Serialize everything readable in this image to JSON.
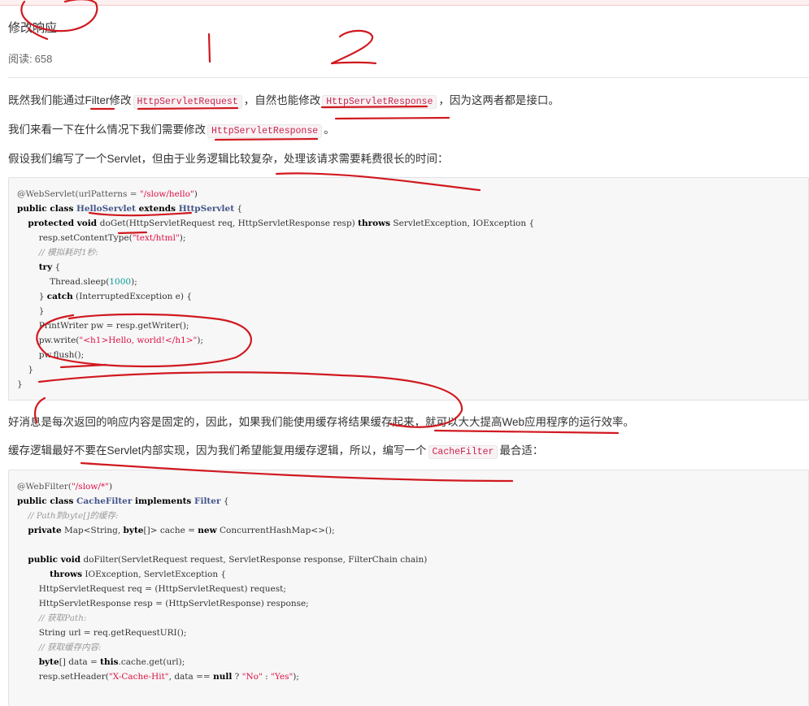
{
  "article": {
    "title": "修改响应",
    "reads_label": "阅读:",
    "reads_count": "658",
    "p1": {
      "t1": "既然我们能通过Filter修改",
      "c1": "HttpServletRequest",
      "t2": "，自然也能修改",
      "c2": "HttpServletResponse",
      "t3": "，因为这两者都是接口。"
    },
    "p2": {
      "t1": "我们来看一下在什么情况下我们需要修改",
      "c1": "HttpServletResponse",
      "t2": "。"
    },
    "p3": "假设我们编写了一个Servlet，但由于业务逻辑比较复杂，处理该请求需要耗费很长的时间：",
    "p4": "好消息是每次返回的响应内容是固定的，因此，如果我们能使用缓存将结果缓存起来，就可以大大提高Web应用程序的运行效率。",
    "p5": {
      "t1": "缓存逻辑最好不要在Servlet内部实现，因为我们希望能复用缓存逻辑，所以，编写一个",
      "c1": "CacheFilter",
      "t2": "最合适："
    }
  },
  "code1": {
    "l1a": "@WebServlet(urlPatterns = ",
    "l1s": "\"/slow/hello\"",
    "l1b": ")",
    "l2k1": "public class ",
    "l2c1": "HelloServlet",
    "l2k2": " extends ",
    "l2c2": "HttpServlet",
    "l2b": " {",
    "l3k1": "protected void ",
    "l3a": "doGet(HttpServletRequest req, HttpServletResponse resp) ",
    "l3k2": "throws",
    "l3b": " ServletException, IOException {",
    "l4a": "resp.setContentType(",
    "l4s": "\"text/html\"",
    "l4b": ");",
    "l5": "// 模拟耗时1秒:",
    "l6k": "try",
    "l6b": " {",
    "l7a": "Thread.sleep(",
    "l7n": "1000",
    "l7b": ");",
    "l8a": "} ",
    "l8k": "catch",
    "l8b": " (InterruptedException e) {",
    "l9": "}",
    "l10": "PrintWriter pw = resp.getWriter();",
    "l11a": "pw.write(",
    "l11s": "\"<h1>Hello, world!</h1>\"",
    "l11b": ");",
    "l12": "pw.flush();",
    "l13": "}",
    "l14": "}"
  },
  "code2": {
    "l1a": "@WebFilter(",
    "l1s": "\"/slow/*\"",
    "l1b": ")",
    "l2k1": "public class ",
    "l2c1": "CacheFilter",
    "l2k2": " implements ",
    "l2c2": "Filter",
    "l2b": " {",
    "l3": "// Path到byte[]的缓存:",
    "l4k1": "private",
    "l4a": " Map<String, ",
    "l4k2": "byte",
    "l4b": "[]> cache = ",
    "l4k3": "new",
    "l4c": " ConcurrentHashMap<>();",
    "l5": "",
    "l6k": "public void",
    "l6a": " doFilter(ServletRequest request, ServletResponse response, FilterChain chain)",
    "l7k": "throws",
    "l7a": " IOException, ServletException {",
    "l8": "HttpServletRequest req = (HttpServletRequest) request;",
    "l9": "HttpServletResponse resp = (HttpServletResponse) response;",
    "l10": "// 获取Path:",
    "l11": "String url = req.getRequestURI();",
    "l12": "// 获取缓存内容:",
    "l13k1": "byte",
    "l13a": "[] data = ",
    "l13k2": "this",
    "l13b": ".cache.get(url);",
    "l14a": "resp.setHeader(",
    "l14s1": "\"X-Cache-Hit\"",
    "l14b": ", data == ",
    "l14k": "null",
    "l14c": " ? ",
    "l14s2": "\"No\"",
    "l14d": " : ",
    "l14s3": "\"Yes\"",
    "l14e": ");"
  },
  "annotations": {
    "digit1": "1",
    "digit2": "2",
    "ink_color": "#d0191f"
  }
}
